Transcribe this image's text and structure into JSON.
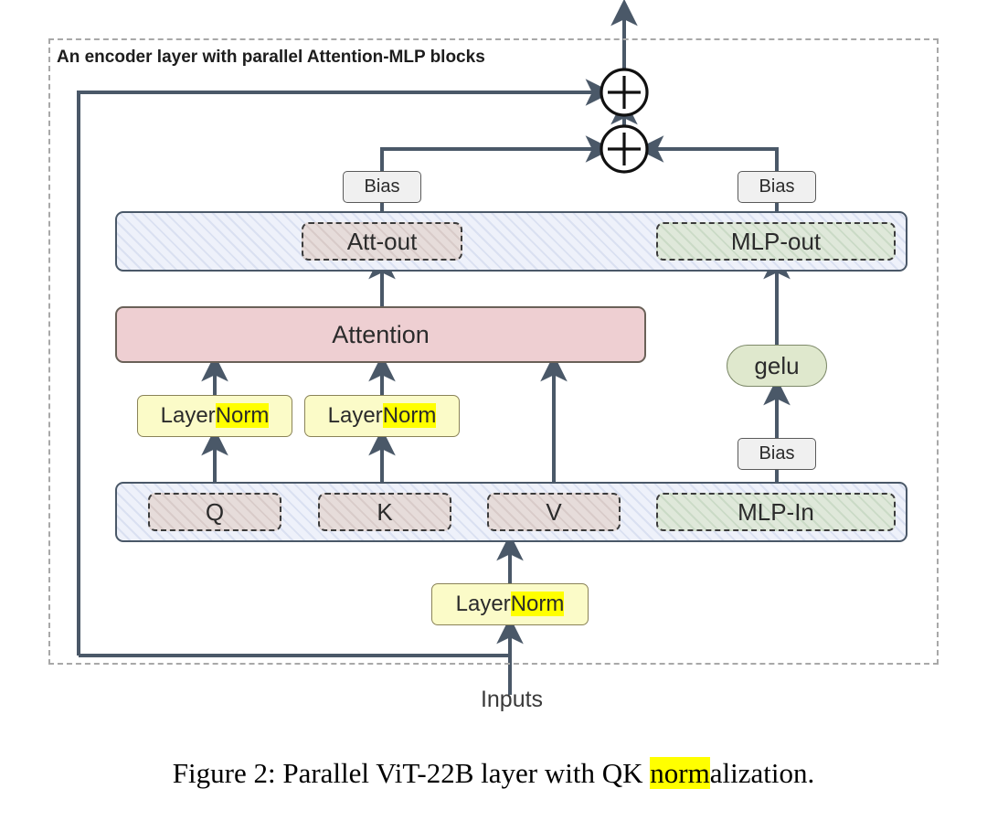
{
  "frame": {
    "title": "An encoder layer with parallel Attention-MLP blocks"
  },
  "nodes": {
    "att_out": "Att-out",
    "mlp_out": "MLP-out",
    "attention": "Attention",
    "gelu": "gelu",
    "q": "Q",
    "k": "K",
    "v": "V",
    "mlp_in": "MLP-In",
    "bias_att": "Bias",
    "bias_mlp": "Bias",
    "bias_mlp_in": "Bias",
    "inputs": "Inputs"
  },
  "layernorm": {
    "prefix": "Layer",
    "highlight": "Norm"
  },
  "caption": {
    "prefix": "Figure 2: Parallel ViT-22B layer with QK ",
    "highlight": "norm",
    "suffix": "alization."
  },
  "operators": {
    "add_top": "+",
    "add_bottom": "+"
  },
  "colors": {
    "line": "#4a5868",
    "frame_dash": "#a8a8a8",
    "container_fill": "#eef1fa",
    "attention_fill": "#eecfd2",
    "qkv_fill": "#e6dcda",
    "mlp_fill": "#dfe8da",
    "gelu_fill": "#dfe8cd",
    "layernorm_fill": "#fbfbc8",
    "highlight": "#ffff00",
    "bias_fill": "#f0f0f0"
  }
}
